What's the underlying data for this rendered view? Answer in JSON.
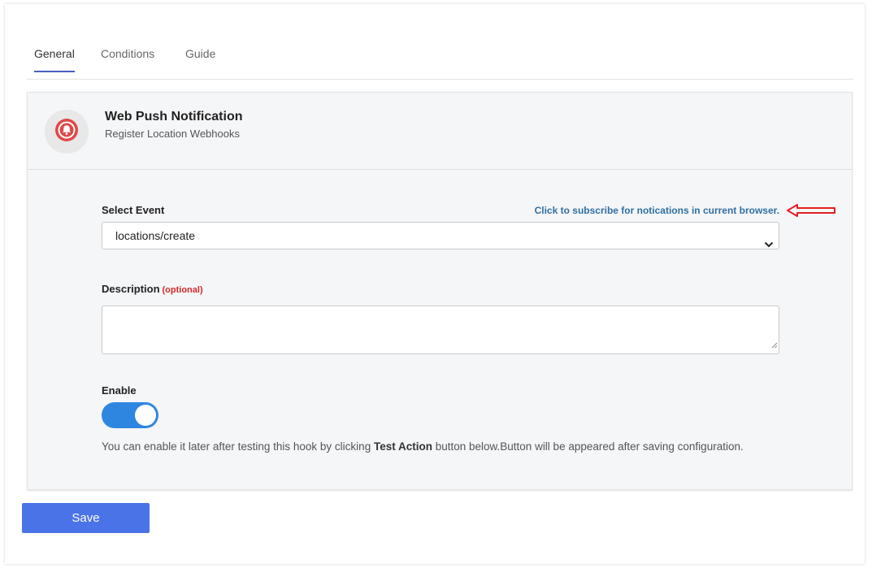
{
  "tabs": [
    {
      "label": "General",
      "active": true
    },
    {
      "label": "Conditions",
      "active": false
    },
    {
      "label": "Guide",
      "active": false
    }
  ],
  "header": {
    "icon": "bell-icon",
    "title": "Web Push Notification",
    "subtitle": "Register Location Webhooks"
  },
  "form": {
    "event_label": "Select Event",
    "subscribe_link": "Click to subscribe for notications in current browser.",
    "event_value": "locations/create",
    "description_label": "Description",
    "description_optional": "(optional)",
    "description_value": "",
    "enable_label": "Enable",
    "enable_on": true,
    "hint_before": "You can enable it later after testing this hook by clicking ",
    "hint_bold": "Test Action",
    "hint_after": " button below.Button will be appeared after saving configuration."
  },
  "actions": {
    "save_label": "Save"
  },
  "colors": {
    "accent": "#4a5fc1",
    "toggle": "#2f86e0",
    "button": "#4b73e8",
    "link": "#2f6fa3",
    "optional": "#d52a2a",
    "bell": "#e04848",
    "annotation_arrow": "#e02020"
  }
}
